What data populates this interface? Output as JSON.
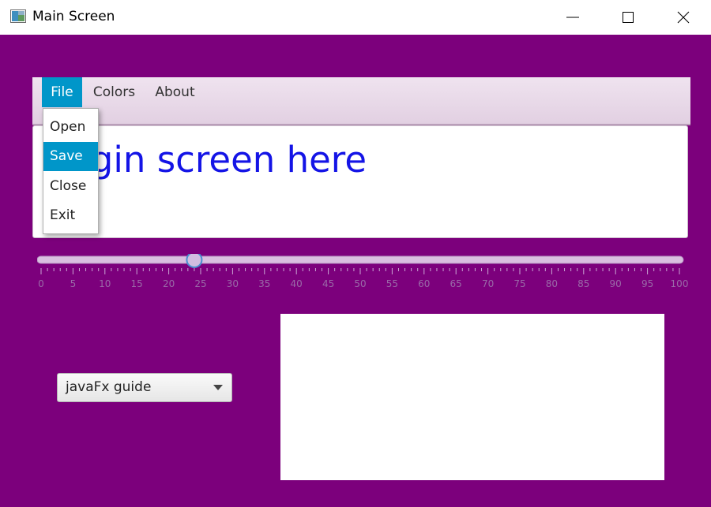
{
  "window": {
    "title": "Main Screen"
  },
  "menubar": {
    "items": [
      {
        "label": "File"
      },
      {
        "label": "Colors"
      },
      {
        "label": "About"
      }
    ]
  },
  "file_menu": {
    "items": [
      {
        "label": "Open"
      },
      {
        "label": "Save"
      },
      {
        "label": "Close"
      },
      {
        "label": "Exit"
      }
    ],
    "highlighted": "Save"
  },
  "panel": {
    "label": "Login screen here"
  },
  "slider": {
    "min": 0,
    "max": 100,
    "value": 24,
    "major_tick_unit": 5,
    "minor_ticks_per_major": 4,
    "tick_labels": [
      "0",
      "5",
      "10",
      "15",
      "20",
      "25",
      "30",
      "35",
      "40",
      "45",
      "50",
      "55",
      "60",
      "65",
      "70",
      "75",
      "80",
      "85",
      "90",
      "95",
      "100"
    ]
  },
  "combo": {
    "value": "javaFx guide"
  },
  "colors": {
    "background": "#7c007c",
    "accent": "#0096c9",
    "label_text": "#1414e6"
  }
}
